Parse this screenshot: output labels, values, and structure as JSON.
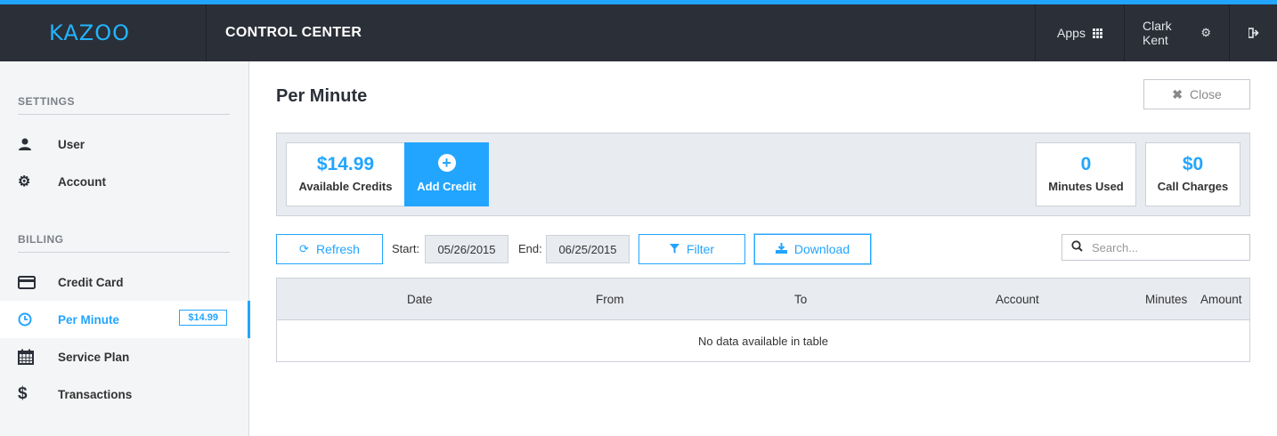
{
  "header": {
    "logo": "KAZOO",
    "title": "CONTROL CENTER",
    "apps_label": "Apps",
    "user_name": "Clark Kent",
    "accent_color": "#22a5ff"
  },
  "sidebar": {
    "sections": [
      {
        "label": "SETTINGS"
      },
      {
        "label": "BILLING"
      }
    ],
    "items": [
      {
        "label": "User",
        "icon": "user-icon"
      },
      {
        "label": "Account",
        "icon": "gears-icon"
      },
      {
        "label": "Credit Card",
        "icon": "credit-card-icon"
      },
      {
        "label": "Per Minute",
        "icon": "clock-icon",
        "badge": "$14.99",
        "active": true
      },
      {
        "label": "Service Plan",
        "icon": "calendar-icon"
      },
      {
        "label": "Transactions",
        "icon": "dollar-icon"
      }
    ]
  },
  "main": {
    "page_title": "Per Minute",
    "close_label": "Close",
    "credits": {
      "value": "$14.99",
      "label": "Available Credits"
    },
    "add_credit_label": "Add Credit",
    "minutes_used": {
      "value": "0",
      "label": "Minutes Used"
    },
    "call_charges": {
      "value": "$0",
      "label": "Call Charges"
    },
    "toolbar": {
      "refresh_label": "Refresh",
      "start_label": "Start:",
      "start_date": "05/26/2015",
      "end_label": "End:",
      "end_date": "06/25/2015",
      "filter_label": "Filter",
      "download_label": "Download",
      "search_placeholder": "Search..."
    },
    "table": {
      "columns": [
        "Date",
        "From",
        "To",
        "Account",
        "Minutes",
        "Amount"
      ],
      "empty_message": "No data available in table"
    }
  }
}
